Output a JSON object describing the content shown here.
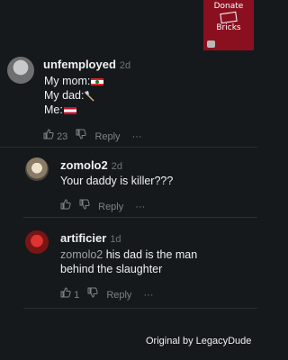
{
  "sticker": {
    "line1": "Donate",
    "line2": "Bricks"
  },
  "comments": [
    {
      "user": "unfemployed",
      "time": "2d",
      "lines": [
        "My mom:",
        "My dad:",
        "Me:"
      ],
      "likes": "23",
      "reply": "Reply",
      "more": "···"
    },
    {
      "user": "zomolo2",
      "time": "2d",
      "text": "Your daddy is killer???",
      "reply": "Reply",
      "more": "···"
    },
    {
      "user": "artificier",
      "time": "1d",
      "mention": "zomolo2",
      "text": "his dad is the man behind the slaughter",
      "likes": "1",
      "reply": "Reply",
      "more": "···"
    }
  ],
  "watermark": "Original by LegacyDude",
  "colors": {
    "background": "#16191b",
    "sticker": "#8a1020",
    "muted": "#7d8286"
  }
}
